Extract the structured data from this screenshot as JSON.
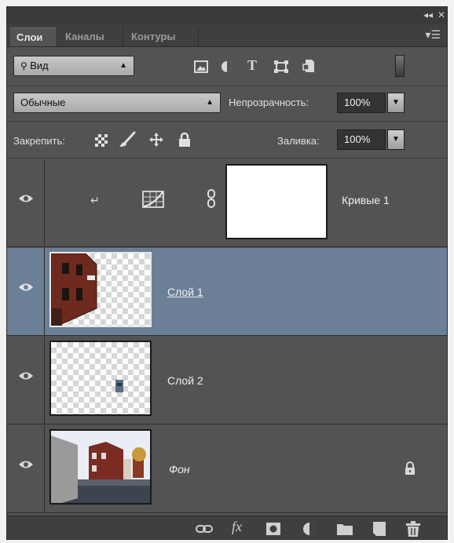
{
  "panel": {
    "window_controls": {
      "collapse": "◂◂",
      "close": "✕"
    },
    "tabs": [
      {
        "label": "Слои",
        "active": true
      },
      {
        "label": "Каналы",
        "active": false
      },
      {
        "label": "Контуры",
        "active": false
      }
    ],
    "menu_icon": "panel-menu-icon"
  },
  "filter": {
    "kind_label": "Вид",
    "icons": [
      "image-filter-icon",
      "adjustment-filter-icon",
      "type-filter-icon",
      "shape-filter-icon",
      "smart-object-filter-icon"
    ],
    "type_glyph": "T"
  },
  "blend": {
    "mode": "Обычные",
    "opacity_label": "Непрозрачность:",
    "opacity_value": "100%"
  },
  "lock": {
    "label": "Закрепить:",
    "fill_label": "Заливка:",
    "fill_value": "100%"
  },
  "layers": [
    {
      "name": "Кривые 1",
      "type": "adjustment",
      "selected": false,
      "visible": true
    },
    {
      "name": "Слой 1",
      "type": "pixel",
      "selected": true,
      "visible": true
    },
    {
      "name": "Слой 2",
      "type": "pixel",
      "selected": false,
      "visible": true
    },
    {
      "name": "Фон",
      "type": "background",
      "selected": false,
      "visible": true,
      "locked": true
    }
  ],
  "bottom_bar": {
    "fx_label": "fx",
    "icons": [
      "link-layers-icon",
      "fx-icon",
      "add-mask-icon",
      "new-adjustment-icon",
      "new-group-icon",
      "new-layer-icon",
      "delete-layer-icon"
    ]
  },
  "colors": {
    "panel_bg": "#535353",
    "selected_layer": "#6b7f97"
  }
}
